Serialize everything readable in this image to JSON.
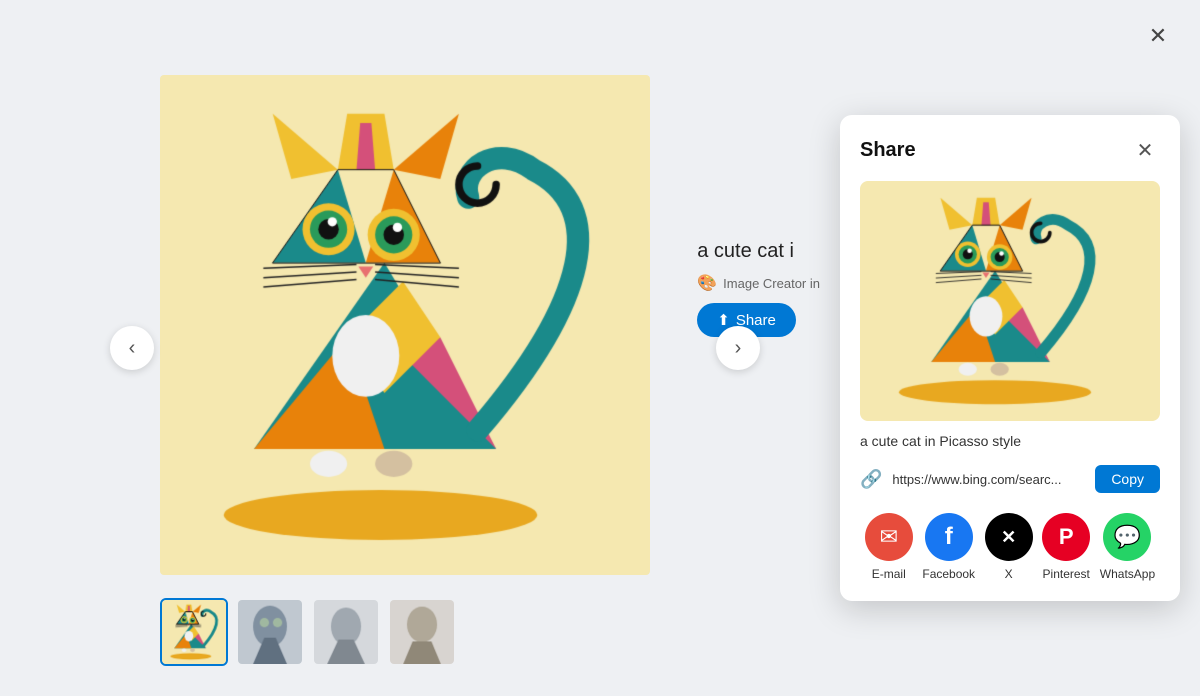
{
  "viewer": {
    "close_label": "✕",
    "nav_left": "‹",
    "nav_right": "›"
  },
  "image": {
    "title": "a cute cat i",
    "creator": "Image Creator in",
    "description": "a cute cat in Picasso style"
  },
  "share_button": {
    "label": "Share",
    "icon": "⬆"
  },
  "share_panel": {
    "title": "Share",
    "close_label": "✕",
    "caption": "a cute cat in Picasso style",
    "url": "https://www.bing.com/searc...",
    "copy_label": "Copy",
    "icons": [
      {
        "id": "email",
        "label": "E-mail",
        "bg": "#e74c3c",
        "symbol": "✉"
      },
      {
        "id": "facebook",
        "label": "Facebook",
        "bg": "#1877f2",
        "symbol": "f"
      },
      {
        "id": "x",
        "label": "X",
        "bg": "#000000",
        "symbol": "𝕏"
      },
      {
        "id": "pinterest",
        "label": "Pinterest",
        "bg": "#e60023",
        "symbol": "P"
      },
      {
        "id": "whatsapp",
        "label": "WhatsApp",
        "bg": "#25d366",
        "symbol": "✆"
      }
    ]
  },
  "thumbnails": [
    {
      "id": "thumb-1",
      "active": true
    },
    {
      "id": "thumb-2",
      "active": false
    },
    {
      "id": "thumb-3",
      "active": false
    },
    {
      "id": "thumb-4",
      "active": false
    }
  ]
}
